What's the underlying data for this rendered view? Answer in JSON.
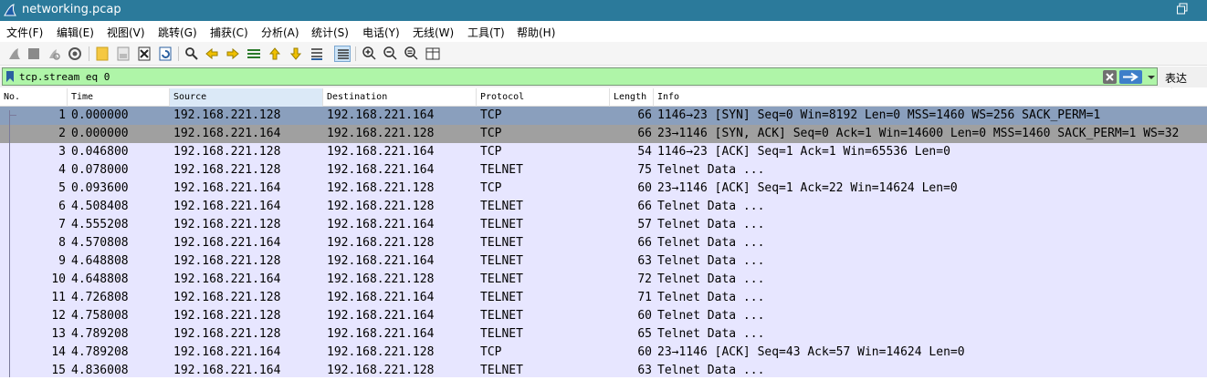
{
  "window": {
    "title": "networking.pcap"
  },
  "menu": [
    "文件(F)",
    "编辑(E)",
    "视图(V)",
    "跳转(G)",
    "捕获(C)",
    "分析(A)",
    "统计(S)",
    "电话(Y)",
    "无线(W)",
    "工具(T)",
    "帮助(H)"
  ],
  "toolbar": {
    "icons": [
      "shark-fin-start-icon",
      "stop-square-icon",
      "restart-icon",
      "capture-options-icon",
      "open-folder-icon",
      "save-file-icon",
      "close-file-icon",
      "reload-icon",
      "find-icon",
      "go-back-icon",
      "go-forward-icon",
      "go-to-packet-icon",
      "first-packet-icon",
      "last-packet-icon",
      "autoscroll-icon",
      "colorize-icon",
      "zoom-in-icon",
      "zoom-out-icon",
      "normal-size-icon",
      "resize-columns-icon"
    ]
  },
  "filter": {
    "value": "tcp.stream eq 0",
    "expression_label": "表达式…"
  },
  "columns": [
    "No.",
    "Time",
    "Source",
    "Destination",
    "Protocol",
    "Length",
    "Info"
  ],
  "packets": [
    {
      "no": "1",
      "time": "0.000000",
      "src": "192.168.221.128",
      "dst": "192.168.221.164",
      "proto": "TCP",
      "len": "66",
      "info": "1146→23 [SYN] Seq=0 Win=8192 Len=0 MSS=1460 WS=256 SACK_PERM=1"
    },
    {
      "no": "2",
      "time": "0.000000",
      "src": "192.168.221.164",
      "dst": "192.168.221.128",
      "proto": "TCP",
      "len": "66",
      "info": "23→1146 [SYN, ACK] Seq=0 Ack=1 Win=14600 Len=0 MSS=1460 SACK_PERM=1 WS=32"
    },
    {
      "no": "3",
      "time": "0.046800",
      "src": "192.168.221.128",
      "dst": "192.168.221.164",
      "proto": "TCP",
      "len": "54",
      "info": "1146→23 [ACK] Seq=1 Ack=1 Win=65536 Len=0"
    },
    {
      "no": "4",
      "time": "0.078000",
      "src": "192.168.221.128",
      "dst": "192.168.221.164",
      "proto": "TELNET",
      "len": "75",
      "info": "Telnet Data ..."
    },
    {
      "no": "5",
      "time": "0.093600",
      "src": "192.168.221.164",
      "dst": "192.168.221.128",
      "proto": "TCP",
      "len": "60",
      "info": "23→1146 [ACK] Seq=1 Ack=22 Win=14624 Len=0"
    },
    {
      "no": "6",
      "time": "4.508408",
      "src": "192.168.221.164",
      "dst": "192.168.221.128",
      "proto": "TELNET",
      "len": "66",
      "info": "Telnet Data ..."
    },
    {
      "no": "7",
      "time": "4.555208",
      "src": "192.168.221.128",
      "dst": "192.168.221.164",
      "proto": "TELNET",
      "len": "57",
      "info": "Telnet Data ..."
    },
    {
      "no": "8",
      "time": "4.570808",
      "src": "192.168.221.164",
      "dst": "192.168.221.128",
      "proto": "TELNET",
      "len": "66",
      "info": "Telnet Data ..."
    },
    {
      "no": "9",
      "time": "4.648808",
      "src": "192.168.221.128",
      "dst": "192.168.221.164",
      "proto": "TELNET",
      "len": "63",
      "info": "Telnet Data ..."
    },
    {
      "no": "10",
      "time": "4.648808",
      "src": "192.168.221.164",
      "dst": "192.168.221.128",
      "proto": "TELNET",
      "len": "72",
      "info": "Telnet Data ..."
    },
    {
      "no": "11",
      "time": "4.726808",
      "src": "192.168.221.128",
      "dst": "192.168.221.164",
      "proto": "TELNET",
      "len": "71",
      "info": "Telnet Data ..."
    },
    {
      "no": "12",
      "time": "4.758008",
      "src": "192.168.221.128",
      "dst": "192.168.221.164",
      "proto": "TELNET",
      "len": "60",
      "info": "Telnet Data ..."
    },
    {
      "no": "13",
      "time": "4.789208",
      "src": "192.168.221.128",
      "dst": "192.168.221.164",
      "proto": "TELNET",
      "len": "65",
      "info": "Telnet Data ..."
    },
    {
      "no": "14",
      "time": "4.789208",
      "src": "192.168.221.164",
      "dst": "192.168.221.128",
      "proto": "TCP",
      "len": "60",
      "info": "23→1146 [ACK] Seq=43 Ack=57 Win=14624 Len=0"
    },
    {
      "no": "15",
      "time": "4.836008",
      "src": "192.168.221.164",
      "dst": "192.168.221.128",
      "proto": "TELNET",
      "len": "63",
      "info": "Telnet Data ..."
    }
  ],
  "colors": {
    "titlebar": "#2b7a9b",
    "filter_valid": "#aff5a8",
    "row_tcp": "#e7e6ff",
    "row_selected": "#8a9fbd"
  }
}
